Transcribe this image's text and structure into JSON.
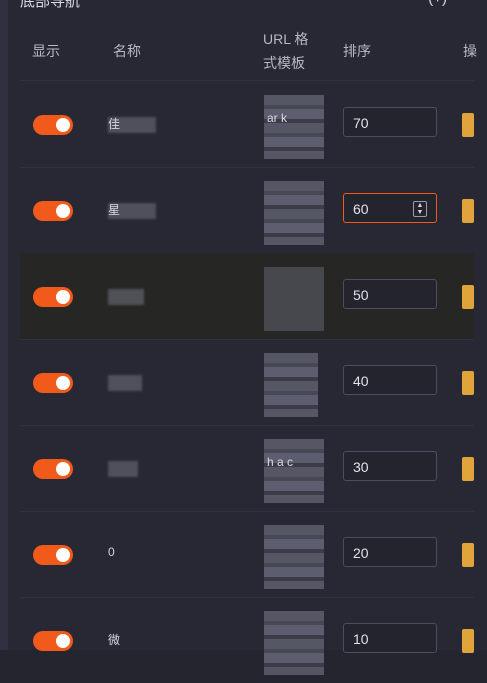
{
  "header": {
    "title_partial": "底部导航",
    "right_partial": "(+)"
  },
  "columns": [
    "显示",
    "名称",
    "URL 格式模板",
    "排序",
    "操"
  ],
  "rows": [
    {
      "name": "佳",
      "url": "ar k",
      "sort": "70"
    },
    {
      "name": "星",
      "url": "",
      "sort": "60",
      "active": true
    },
    {
      "name": "",
      "url": "",
      "sort": "50",
      "hover": true
    },
    {
      "name": "",
      "url": "",
      "sort": "40"
    },
    {
      "name": "",
      "url": "h a c",
      "sort": "30"
    },
    {
      "name": "0",
      "url": "",
      "sort": "20"
    },
    {
      "name": "微",
      "url": "",
      "sort": "10"
    }
  ],
  "colors": {
    "toggle_on": "#f25a1c",
    "action": "#e0a43a",
    "panel": "#272834"
  }
}
